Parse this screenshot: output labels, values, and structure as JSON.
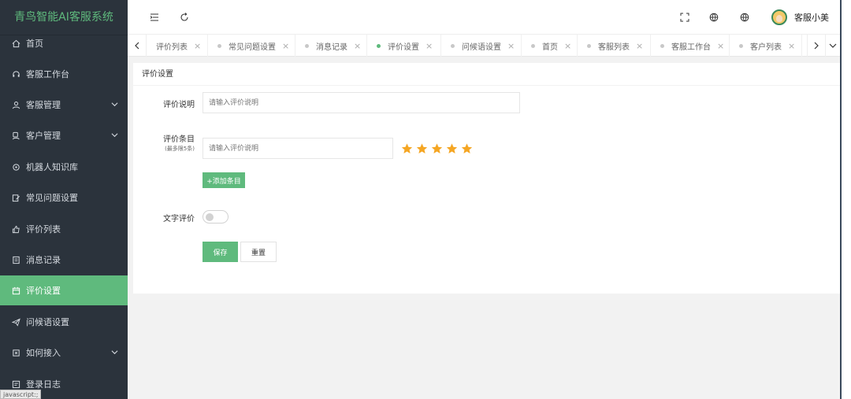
{
  "app": {
    "title": "青鸟智能AI客服系统"
  },
  "sidebar": {
    "items": [
      {
        "label": "首页",
        "icon": "home-icon",
        "expandable": false
      },
      {
        "label": "客服工作台",
        "icon": "headset-icon",
        "expandable": false
      },
      {
        "label": "客服管理",
        "icon": "user-icon",
        "expandable": true
      },
      {
        "label": "客户管理",
        "icon": "customer-icon",
        "expandable": true
      },
      {
        "label": "机器人知识库",
        "icon": "robot-icon",
        "expandable": false
      },
      {
        "label": "常见问题设置",
        "icon": "edit-icon",
        "expandable": false
      },
      {
        "label": "评价列表",
        "icon": "thumbs-up-icon",
        "expandable": false
      },
      {
        "label": "消息记录",
        "icon": "document-icon",
        "expandable": false
      },
      {
        "label": "评价设置",
        "icon": "calendar-icon",
        "expandable": false,
        "active": true
      },
      {
        "label": "问候语设置",
        "icon": "send-icon",
        "expandable": false
      },
      {
        "label": "如何接入",
        "icon": "plug-icon",
        "expandable": true
      },
      {
        "label": "登录日志",
        "icon": "log-icon",
        "expandable": false
      }
    ],
    "status_hint": "javascript:;"
  },
  "header": {
    "user_name": "客服小美"
  },
  "tabs": {
    "items": [
      {
        "label": "评价列表"
      },
      {
        "label": "常见问题设置"
      },
      {
        "label": "消息记录"
      },
      {
        "label": "评价设置",
        "active": true
      },
      {
        "label": "问候语设置"
      },
      {
        "label": "首页"
      },
      {
        "label": "客服列表"
      },
      {
        "label": "客服工作台"
      },
      {
        "label": "客户列表"
      }
    ],
    "close_glyph": "×"
  },
  "form": {
    "card_title": "评价设置",
    "desc_label": "评价说明",
    "desc_placeholder": "请输入评价说明",
    "item_label": "评价条目",
    "item_sublabel": "(最多限5条)",
    "item_placeholder": "请输入评价说明",
    "rating_stars": 5,
    "star_color": "#f5a623",
    "add_button": "+添加条目",
    "text_eval_label": "文字评价",
    "text_eval_enabled": false,
    "save_button": "保存",
    "reset_button": "重置"
  },
  "colors": {
    "accent": "#5fba7d",
    "sidebar_bg": "#2b333c"
  }
}
